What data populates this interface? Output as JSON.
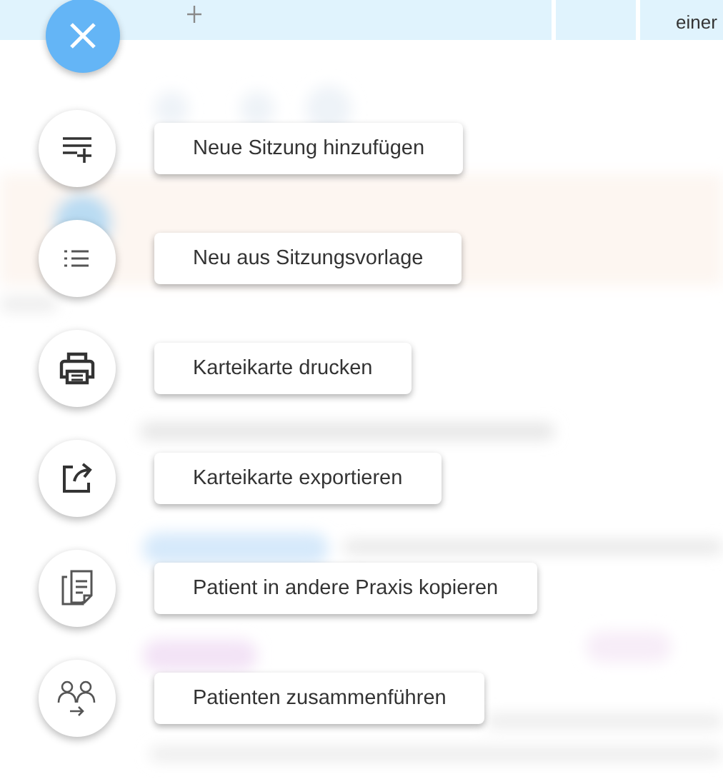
{
  "background_row": {
    "cell_text": "einer"
  },
  "speed_dial": {
    "open": true,
    "actions": [
      {
        "kind": "add-session",
        "label": "Neue Sitzung hinzufügen"
      },
      {
        "kind": "list",
        "label": "Neu aus Sitzungsvorlage"
      },
      {
        "kind": "print",
        "label": "Karteikarte drucken"
      },
      {
        "kind": "export",
        "label": "Karteikarte exportieren"
      },
      {
        "kind": "copy",
        "label": "Patient in andere Praxis kopieren"
      },
      {
        "kind": "merge",
        "label": "Patienten zusammenführen"
      }
    ]
  }
}
